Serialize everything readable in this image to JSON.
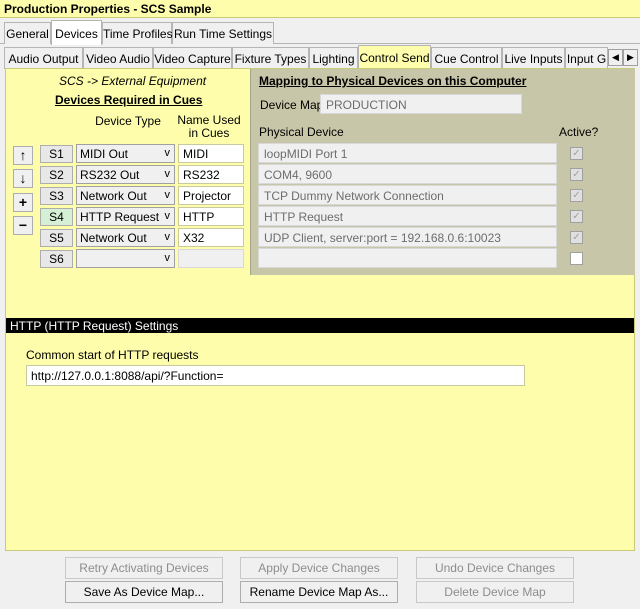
{
  "window": {
    "title": "Production Properties - SCS Sample"
  },
  "tabs_main": [
    "General",
    "Devices",
    "Time Profiles",
    "Run Time Settings"
  ],
  "tabs_sub": [
    "Audio Output",
    "Video Audio",
    "Video Capture",
    "Fixture Types",
    "Lighting",
    "Control Send",
    "Cue Control",
    "Live Inputs",
    "Input G"
  ],
  "tab_scroll": {
    "left": "◀",
    "right": "▶"
  },
  "left": {
    "direction": "SCS -> External Equipment",
    "required_heading": "Devices Required in Cues",
    "col_device_type": "Device Type",
    "col_name_used": "Name Used in Cues",
    "side_buttons": [
      "↑",
      "↓",
      "+",
      "−"
    ],
    "devices": [
      {
        "slot": "S1",
        "type": "MIDI Out",
        "name": "MIDI",
        "v": "v"
      },
      {
        "slot": "S2",
        "type": "RS232 Out",
        "name": "RS232",
        "v": "v"
      },
      {
        "slot": "S3",
        "type": "Network Out",
        "name": "Projector",
        "v": "v"
      },
      {
        "slot": "S4",
        "type": "HTTP Request",
        "name": "HTTP",
        "v": "v"
      },
      {
        "slot": "S5",
        "type": "Network Out",
        "name": "X32",
        "v": "v"
      },
      {
        "slot": "S6",
        "type": "",
        "name": "",
        "v": "v"
      }
    ]
  },
  "mapping": {
    "title": "Mapping to Physical Devices on this Computer",
    "device_map_label": "Device Map",
    "device_map_value": "PRODUCTION",
    "physical_header": "Physical Device",
    "active_header": "Active?",
    "rows": [
      {
        "device": "loopMIDI Port 1",
        "active": "✓"
      },
      {
        "device": "COM4, 9600",
        "active": "✓"
      },
      {
        "device": "TCP Dummy Network Connection",
        "active": "✓"
      },
      {
        "device": "HTTP Request",
        "active": "✓"
      },
      {
        "device": "UDP Client, server:port = 192.168.0.6:10023",
        "active": "✓"
      },
      {
        "device": "",
        "active": ""
      }
    ]
  },
  "http_settings": {
    "section_title": "HTTP (HTTP Request) Settings",
    "common_label": "Common start of HTTP requests",
    "common_value": "http://127.0.0.1:8088/api/?Function="
  },
  "buttons": {
    "retry": "Retry Activating Devices",
    "apply": "Apply Device Changes",
    "undo": "Undo Device Changes",
    "save_as": "Save As Device Map...",
    "rename": "Rename Device Map As...",
    "delete": "Delete Device Map"
  },
  "colors": {
    "panel": "#fdfdab",
    "mapping_panel": "#c8c6a8",
    "section_bar": "#000000"
  }
}
